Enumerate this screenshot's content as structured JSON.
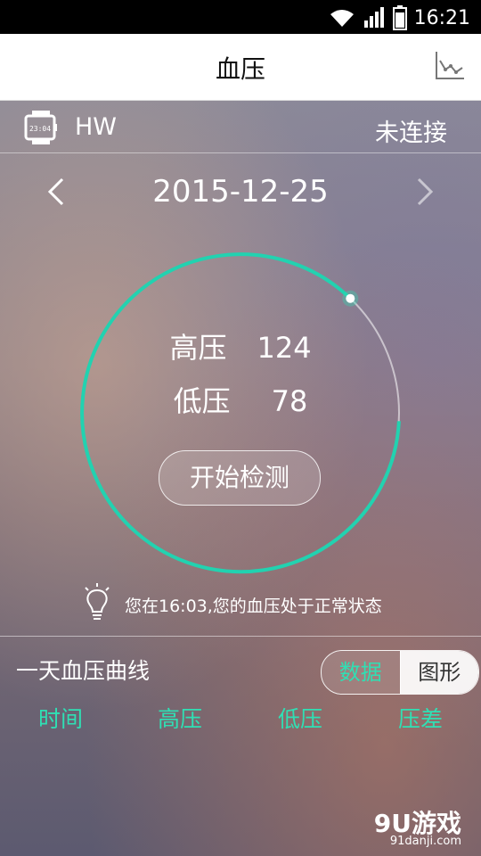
{
  "status_bar": {
    "time": "16:21"
  },
  "header": {
    "title": "血压"
  },
  "device": {
    "name": "HW",
    "status": "未连接"
  },
  "date": {
    "value": "2015-12-25"
  },
  "measurement": {
    "systolic_label": "高压",
    "systolic_value": "124",
    "diastolic_label": "低压",
    "diastolic_value": "78",
    "start_button_label": "开始检测"
  },
  "tip": {
    "text": "您在16:03,您的血压处于正常状态"
  },
  "daily_section": {
    "title": "一天血压曲线",
    "toggle": {
      "data_label": "数据",
      "graph_label": "图形",
      "selected": "数据"
    },
    "columns": [
      "时间",
      "高压",
      "低压",
      "压差"
    ]
  },
  "colors": {
    "accent": "#2fe0b4",
    "titlebar_bg": "#ffffff"
  },
  "icons": {
    "wifi": "wifi-icon",
    "signal": "signal-icon",
    "battery": "battery-icon",
    "chart": "line-chart-icon",
    "watch": "watch-icon",
    "bulb": "lightbulb-icon",
    "prev": "chevron-left-icon",
    "next": "chevron-right-icon"
  },
  "watermark": {
    "brand": "9U游戏",
    "site": "91danji.com"
  }
}
